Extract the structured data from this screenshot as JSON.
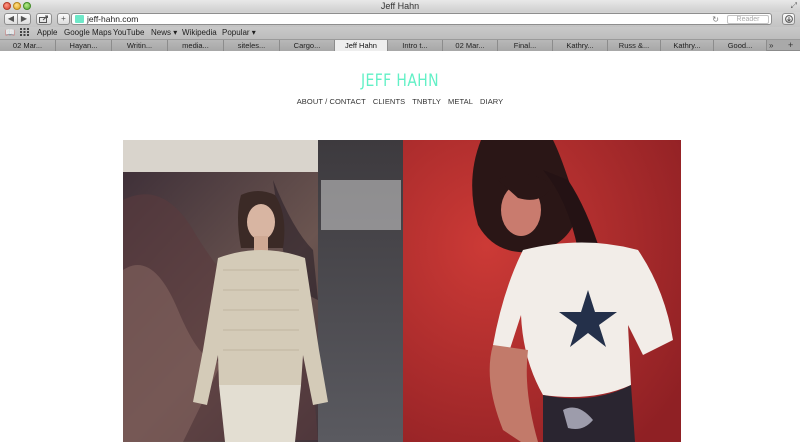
{
  "window": {
    "title": "Jeff Hahn"
  },
  "toolbar": {
    "back_icon": "back-arrow-icon",
    "forward_icon": "forward-arrow-icon",
    "url": "jeff-hahn.com",
    "reader_label": "Reader"
  },
  "bookmarks": {
    "items": [
      {
        "label": "Apple"
      },
      {
        "label": "Google Maps"
      },
      {
        "label": "YouTube"
      },
      {
        "label": "News ▾"
      },
      {
        "label": "Wikipedia"
      },
      {
        "label": "Popular ▾"
      }
    ]
  },
  "tabs": {
    "items": [
      {
        "label": "02 Mar..."
      },
      {
        "label": "Hayan..."
      },
      {
        "label": "Writin..."
      },
      {
        "label": "media..."
      },
      {
        "label": "siteles..."
      },
      {
        "label": "Cargo..."
      },
      {
        "label": "Jeff Hahn",
        "active": true
      },
      {
        "label": "Intro t..."
      },
      {
        "label": "02 Mar..."
      },
      {
        "label": "Final..."
      },
      {
        "label": "Kathry..."
      },
      {
        "label": "Russ &..."
      },
      {
        "label": "Kathry..."
      },
      {
        "label": "Good..."
      }
    ],
    "overflow_label": "»",
    "add_label": "+"
  },
  "site": {
    "title": "JEFF HAHN",
    "accent_color": "#62f0c6",
    "nav": [
      {
        "label": "ABOUT / CONTACT"
      },
      {
        "label": "CLIENTS"
      },
      {
        "label": "TNBTLY"
      },
      {
        "label": "METAL"
      },
      {
        "label": "DIARY"
      }
    ]
  },
  "gallery": {
    "images": [
      {
        "name": "photo-woman-knit-sweater",
        "palette": [
          "#3c2f38",
          "#8a6a5a",
          "#d8d2c2"
        ]
      },
      {
        "name": "photo-woman-star-tshirt",
        "palette": [
          "#b8312f",
          "#f2eeea",
          "#2a3550"
        ]
      }
    ]
  }
}
